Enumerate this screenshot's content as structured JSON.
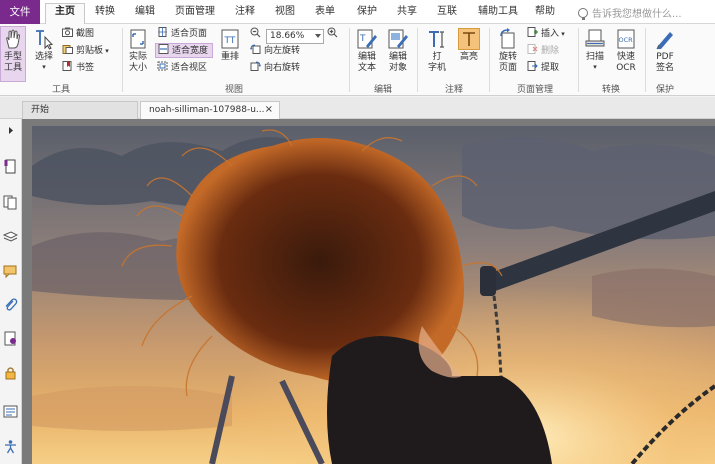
{
  "menu": {
    "file": "文件",
    "items": [
      "主页",
      "转换",
      "编辑",
      "页面管理",
      "注释",
      "视图",
      "表单",
      "保护",
      "共享",
      "互联",
      "辅助工具",
      "帮助"
    ],
    "tell_me": "告诉我您想做什么..."
  },
  "ribbon": {
    "tools": {
      "hand": "手型\n工具",
      "select": "选择",
      "screenshot": "截图",
      "clipboard": "剪贴板",
      "bookmark": "书签",
      "label": "工具"
    },
    "view": {
      "actual_size": "实际\n大小",
      "fit_page": "适合页面",
      "fit_width": "适合宽度",
      "fit_visible": "适合视区",
      "reflow": "重排",
      "zoom_value": "18.66%",
      "rotate_left": "向左旋转",
      "rotate_right": "向右旋转",
      "label": "视图"
    },
    "edit": {
      "edit_text": "编辑\n文本",
      "edit_object": "编辑\n对象",
      "label": "编辑"
    },
    "annotate": {
      "typewriter": "打\n字机",
      "highlight": "高亮",
      "label": "注释"
    },
    "page": {
      "rotate_page": "旋转\n页面",
      "insert": "插入",
      "delete": "删除",
      "extract": "提取",
      "label": "页面管理"
    },
    "convert": {
      "scan": "扫描",
      "quick_ocr": "快速\nOCR",
      "label": "转换"
    },
    "protect": {
      "pdf_sign": "PDF\n签名",
      "label": "保护"
    }
  },
  "tabs": [
    {
      "label": "开始"
    },
    {
      "label": "noah-silliman-107988-u...",
      "close": "×"
    }
  ],
  "colors": {
    "accent": "#7a2a8c",
    "active_tab_bg": "#e7d6ee",
    "viewer_bg": "#7a7a7a"
  }
}
